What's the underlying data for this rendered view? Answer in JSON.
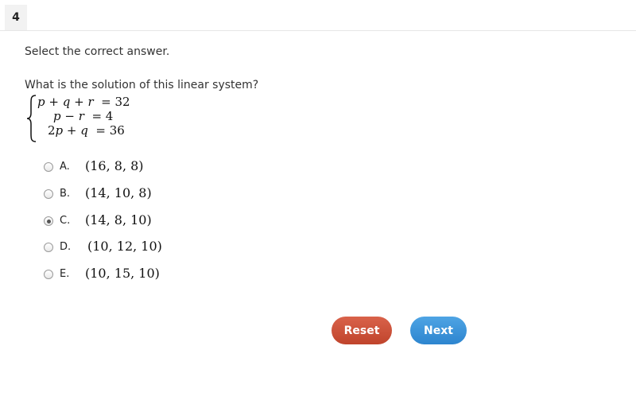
{
  "question": {
    "number": "4",
    "instruction": "Select the correct answer.",
    "prompt": "What is the solution of this linear system?"
  },
  "system": {
    "equations": [
      {
        "lhs": [
          "p",
          " + ",
          "q",
          " + ",
          "r"
        ],
        "rhs": "32"
      },
      {
        "lhs": [
          "p",
          " − ",
          "r"
        ],
        "rhs": "4"
      },
      {
        "lhs": [
          "2",
          "p",
          " + ",
          "q"
        ],
        "rhs": "36"
      }
    ]
  },
  "options": [
    {
      "letter": "A.",
      "value": "(16, 8, 8)",
      "selected": false
    },
    {
      "letter": "B.",
      "value": "(14, 10, 8)",
      "selected": false
    },
    {
      "letter": "C.",
      "value": "(14, 8, 10)",
      "selected": true
    },
    {
      "letter": "D.",
      "value": "(10, 12, 10)",
      "selected": false
    },
    {
      "letter": "E.",
      "value": "(10, 15, 10)",
      "selected": false
    }
  ],
  "buttons": {
    "reset_label": "Reset",
    "next_label": "Next"
  },
  "colors": {
    "reset": "#c9503a",
    "next": "#3b95dc"
  }
}
